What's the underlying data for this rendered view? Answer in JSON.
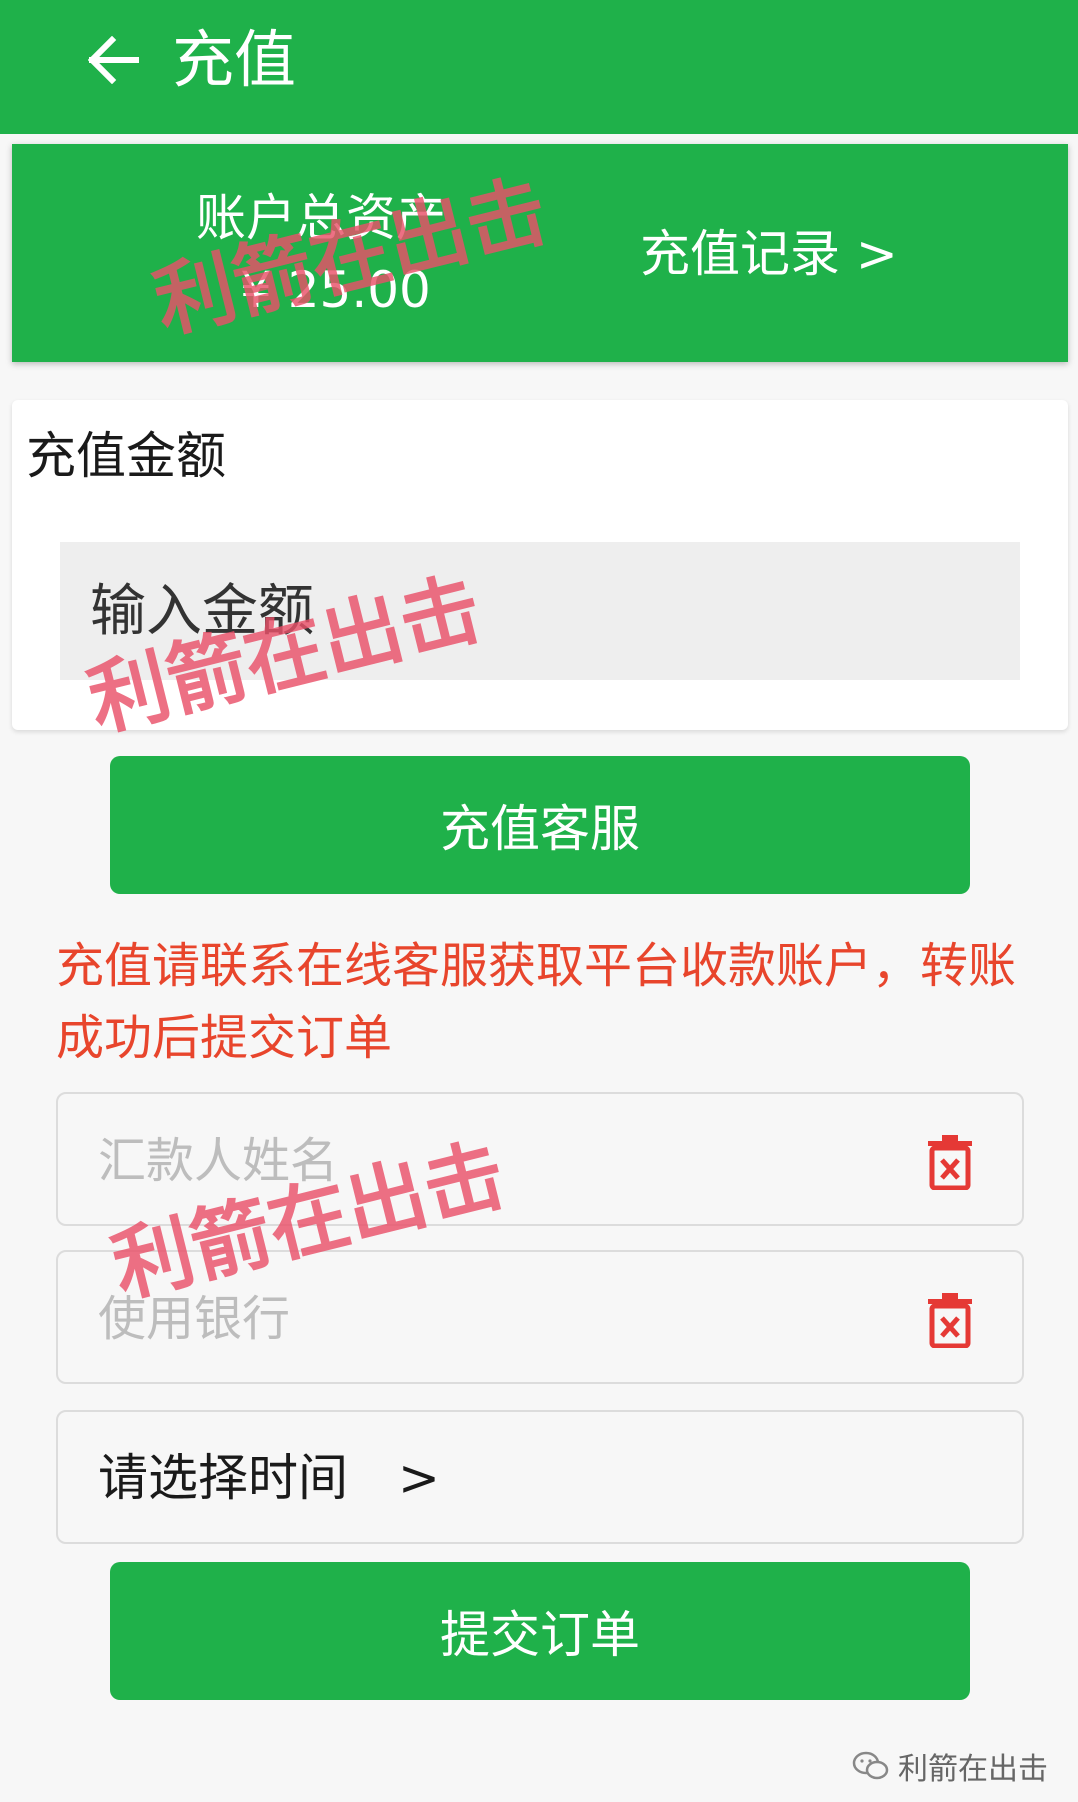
{
  "header": {
    "title": "充值",
    "back_icon": "arrow-left-icon"
  },
  "account": {
    "total_assets_label": "账户总资产",
    "total_assets_value": "¥ 25.00",
    "records_link": "充值记录 >"
  },
  "amount": {
    "label": "充值金额",
    "placeholder": "输入金额"
  },
  "service_button": "充值客服",
  "notice": "充值请联系在线客服获取平台收款账户，转账成功后提交订单",
  "form": {
    "remitter_placeholder": "汇款人姓名",
    "bank_placeholder": "使用银行",
    "time_select": "请选择时间　>",
    "delete_icon": "trash-icon"
  },
  "submit_button": "提交订单",
  "watermark": "利箭在出击",
  "footer_brand": "利箭在出击",
  "colors": {
    "primary_green": "#1fb14a",
    "notice_red": "#e8452c",
    "delete_red": "#e53935",
    "watermark_pink": "#e95069"
  }
}
